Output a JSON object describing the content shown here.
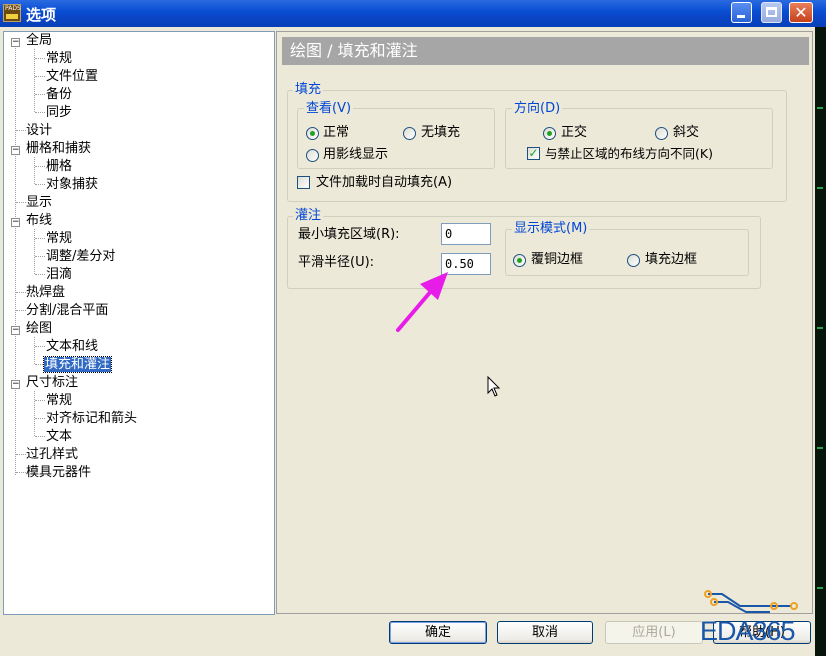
{
  "window": {
    "title": "选项",
    "app_icon_text": "PADS"
  },
  "tree": {
    "items": [
      {
        "label": "全局",
        "level": 0,
        "expander": "−"
      },
      {
        "label": "常规",
        "level": 1
      },
      {
        "label": "文件位置",
        "level": 1
      },
      {
        "label": "备份",
        "level": 1
      },
      {
        "label": "同步",
        "level": 1
      },
      {
        "label": "设计",
        "level": 0
      },
      {
        "label": "栅格和捕获",
        "level": 0,
        "expander": "−"
      },
      {
        "label": "栅格",
        "level": 1
      },
      {
        "label": "对象捕获",
        "level": 1
      },
      {
        "label": "显示",
        "level": 0
      },
      {
        "label": "布线",
        "level": 0,
        "expander": "−"
      },
      {
        "label": "常规",
        "level": 1
      },
      {
        "label": "调整/差分对",
        "level": 1
      },
      {
        "label": "泪滴",
        "level": 1
      },
      {
        "label": "热焊盘",
        "level": 0
      },
      {
        "label": "分割/混合平面",
        "level": 0
      },
      {
        "label": "绘图",
        "level": 0,
        "expander": "−"
      },
      {
        "label": "文本和线",
        "level": 1
      },
      {
        "label": "填充和灌注",
        "level": 1,
        "selected": true
      },
      {
        "label": "尺寸标注",
        "level": 0,
        "expander": "−"
      },
      {
        "label": "常规",
        "level": 1
      },
      {
        "label": "对齐标记和箭头",
        "level": 1
      },
      {
        "label": "文本",
        "level": 1
      },
      {
        "label": "过孔样式",
        "level": 0
      },
      {
        "label": "模具元器件",
        "level": 0
      }
    ]
  },
  "panel": {
    "header": "绘图 / 填充和灌注",
    "fill": {
      "label": "填充",
      "view": {
        "label": "查看(V)",
        "normal": "正常",
        "no_fill": "无填充",
        "hatch": "用影线显示",
        "selected": "normal"
      },
      "direction": {
        "label": "方向(D)",
        "orthogonal": "正交",
        "diagonal": "斜交",
        "selected": "orthogonal",
        "keepout_diff": "与禁止区域的布线方向不同(K)",
        "keepout_diff_checked": true
      },
      "autofill_on_load": "文件加载时自动填充(A)",
      "autofill_checked": false
    },
    "pour": {
      "label": "灌注",
      "min_fill_area_label": "最小填充区域(R):",
      "min_fill_area_value": "0",
      "smooth_radius_label": "平滑半径(U):",
      "smooth_radius_value": "0.50",
      "display_mode": {
        "label": "显示模式(M)",
        "copper_outline": "覆铜边框",
        "fill_outline": "填充边框",
        "selected": "copper_outline"
      }
    }
  },
  "buttons": {
    "ok": "确定",
    "cancel": "取消",
    "apply": "应用(L)",
    "help": "帮助(H)"
  },
  "watermark": {
    "text": "EDA365"
  },
  "colors": {
    "titlebar": "#0a4fd4",
    "group_label": "#0046d5",
    "selection": "#316ac5",
    "arrow": "#e81ce8"
  }
}
